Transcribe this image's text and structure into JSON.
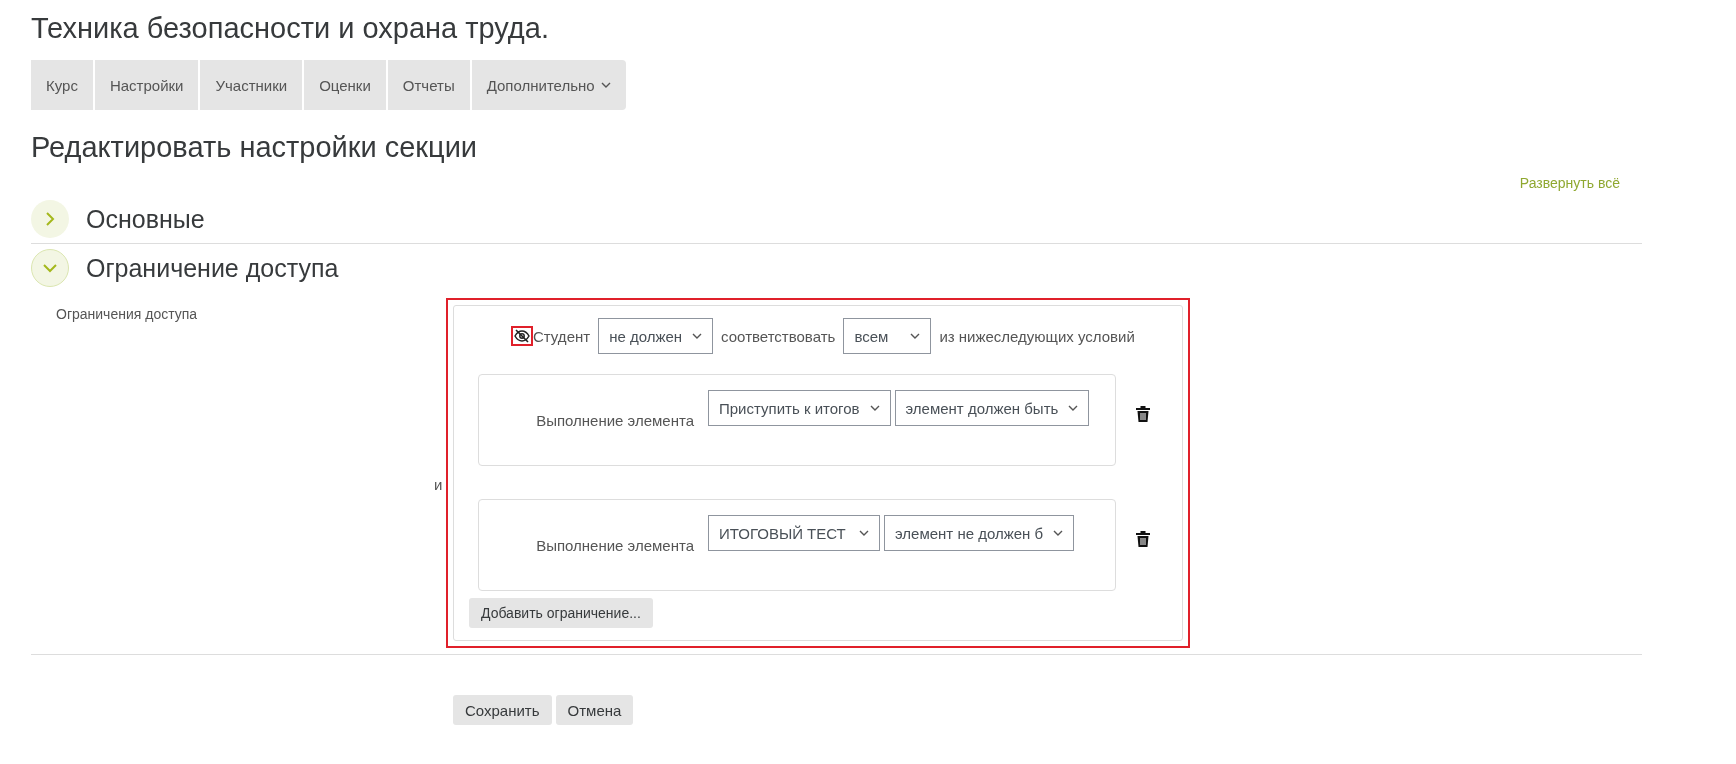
{
  "course_title": "Техника безопасности и охрана труда.",
  "nav_tabs": [
    {
      "label": "Курс",
      "dropdown": false
    },
    {
      "label": "Настройки",
      "dropdown": false
    },
    {
      "label": "Участники",
      "dropdown": false
    },
    {
      "label": "Оценки",
      "dropdown": false
    },
    {
      "label": "Отчеты",
      "dropdown": false
    },
    {
      "label": "Дополнительно",
      "dropdown": true
    }
  ],
  "page_heading": "Редактировать настройки секции",
  "expand_all_link": "Развернуть всё",
  "sections": [
    {
      "title": "Основные",
      "expanded": false
    },
    {
      "title": "Ограничение доступа",
      "expanded": true
    }
  ],
  "restrictions": {
    "label": "Ограничения доступа",
    "header": {
      "subject": "Студент",
      "must": "не должен",
      "match_text": "соответствовать",
      "scope": "всем",
      "tail": "из нижеследующих условий"
    },
    "conditions": [
      {
        "label": "Выполнение элемента",
        "activity": "Приступить к итогов",
        "requirement": "элемент должен быть"
      },
      {
        "label": "Выполнение элемента",
        "activity": "ИТОГОВЫЙ ТЕСТ",
        "requirement": "элемент не должен б"
      }
    ],
    "connector": "и",
    "add_button": "Добавить ограничение..."
  },
  "buttons": [
    "Сохранить",
    "Отмена"
  ]
}
